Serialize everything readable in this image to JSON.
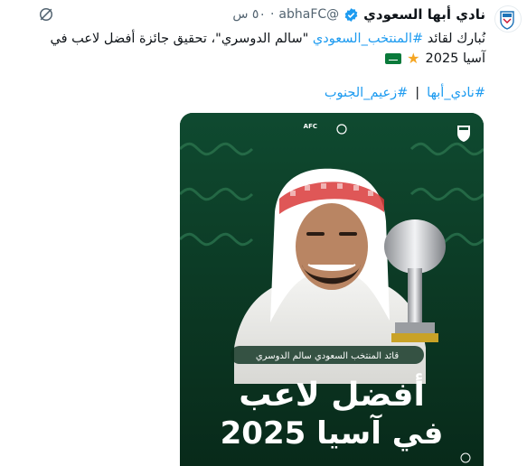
{
  "author": {
    "name": "نادي أبها السعودي",
    "handle": "@abhaFC",
    "dot": "·",
    "time": "٥٠ س"
  },
  "post": {
    "text_prefix": "نُبارك لقائد",
    "hashtag_team": "#المنتخب_السعودي",
    "text_mid": "\"سالم الدوسري\"، تحقيق جائزة أفضل لاعب في",
    "text_line2": "آسيا 2025",
    "hashtag_1": "#نادي_أبها",
    "separator": "|",
    "hashtag_2": "#زعيم_الجنوب"
  },
  "media": {
    "logo_text": "AFC",
    "caption_small": "قائد المنتخب السعودي سالم الدوسري",
    "title_line1": "أفضل لاعب",
    "title_line2": "في آسيا 2025"
  },
  "colors": {
    "link": "#1d9bf0",
    "verified": "#1d9bf0",
    "media_bg": "#0d3a26",
    "star": "#f5a623"
  },
  "icons": [
    "verified-badge-icon",
    "grok-icon",
    "star-emoji",
    "saudi-flag-emoji",
    "club-crest-icon"
  ]
}
